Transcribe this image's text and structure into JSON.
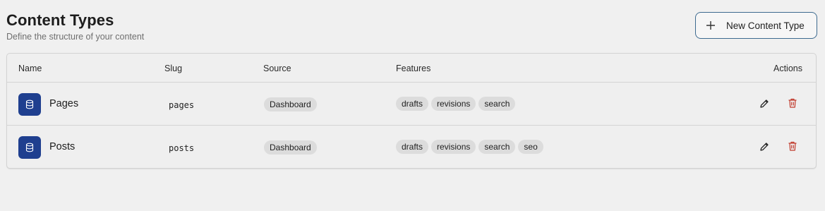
{
  "header": {
    "title": "Content Types",
    "subtitle": "Define the structure of your content",
    "new_button_label": "New Content Type"
  },
  "table": {
    "columns": {
      "name": "Name",
      "slug": "Slug",
      "source": "Source",
      "features": "Features",
      "actions": "Actions"
    },
    "rows": [
      {
        "name": "Pages",
        "slug": "pages",
        "source": "Dashboard",
        "features": [
          "drafts",
          "revisions",
          "search"
        ]
      },
      {
        "name": "Posts",
        "slug": "posts",
        "source": "Dashboard",
        "features": [
          "drafts",
          "revisions",
          "search",
          "seo"
        ]
      }
    ]
  },
  "icons": {
    "new": "plus-icon",
    "type": "database-icon",
    "edit": "pencil-icon",
    "delete": "trash-icon"
  },
  "colors": {
    "accent": "#1f3f8f",
    "danger": "#c0392b",
    "button_border": "#3d6a8f"
  }
}
